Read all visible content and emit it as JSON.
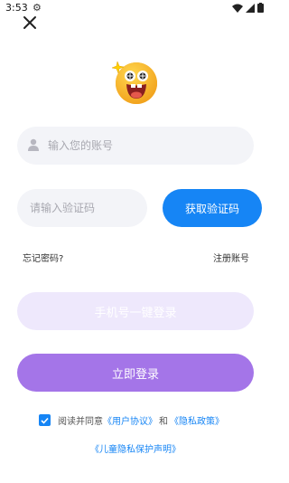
{
  "status_bar": {
    "time": "3:53",
    "settings_icon": "gear-icon"
  },
  "account": {
    "placeholder": "输入您的账号"
  },
  "code": {
    "placeholder": "请输入验证码",
    "button": "获取验证码"
  },
  "links": {
    "forgot": "忘记密码?",
    "register": "注册账号"
  },
  "buttons": {
    "phone_login": "手机号一键登录",
    "login_now": "立即登录"
  },
  "agreement": {
    "prefix": "阅读并同意",
    "user_agreement": "《用户协议》",
    "conjunction": "和",
    "privacy": "《隐私政策》",
    "child_privacy": "《儿童隐私保护声明》",
    "checked": true
  },
  "colors": {
    "primary_blue": "#1685f5",
    "purple": "#a475e8",
    "light_purple": "#eee8fc",
    "field_bg": "#f3f4f8"
  }
}
